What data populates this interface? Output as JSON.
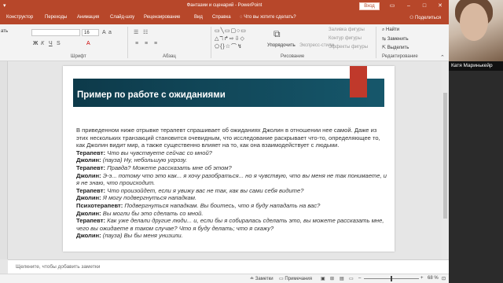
{
  "titlebar": {
    "title": "Фантазии и сценарий - PowerPoint",
    "login": "Вход"
  },
  "tabs": [
    "Конструктор",
    "Переходы",
    "Анимация",
    "Слайд-шоу",
    "Рецензирование",
    "Вид",
    "Справка"
  ],
  "tell_me": "Что вы хотите сделать?",
  "share": "Поделиться",
  "ribbon": {
    "paste_label": "ать",
    "font_size": "16",
    "groups": [
      "Шрифт",
      "Абзац",
      "Рисование",
      "Редактирование"
    ],
    "arrange": "Упорядочить",
    "quick_styles": "Экспресс-стили",
    "shape_fill": "Заливка фигуры",
    "shape_outline": "Контур фигуры",
    "shape_effects": "Эффекты фигуры",
    "find": "Найти",
    "replace": "Заменить",
    "select": "Выделить"
  },
  "slide": {
    "title": "Пример по работе с ожиданиями",
    "intro": "В приведенном ниже отрывке терапевт спрашивает об ожиданиях Джолин в отношении нее самой. Даже из этих нескольких транзакций становится очевидным, что исследование раскрывает что-то, определяющее то, как Джолин видит мир, а также существенно влияет на то, как она взаимодействует с людьми.",
    "lines": [
      {
        "speaker": "Терапевт:",
        "text": "Что вы чувствуете сейчас со мной?"
      },
      {
        "speaker": "Джолин:",
        "text": "(пауза) Ну, небольшую угрозу."
      },
      {
        "speaker": "Терапевт:",
        "text": "Правда? Можете рассказать мне об этом?"
      },
      {
        "speaker": "Джолин:",
        "text": "Э-э... потому что это как... я хочу разобраться... но я чувствую, что вы меня не так понимаете, и я не знаю, что происходит."
      },
      {
        "speaker": "Терапевт:",
        "text": "Что произойдет, если я увижу вас не так, как вы сами себя видите?"
      },
      {
        "speaker": "Джолин:",
        "text": "Я могу подвергнуться нападкам."
      },
      {
        "speaker": "Психотерапевт:",
        "text": "Подвергнуться нападкам. Вы боитесь, что я буду нападать на вас?"
      },
      {
        "speaker": "Джолин:",
        "text": "Вы могли бы это сделать со мной."
      },
      {
        "speaker": "Терапевт:",
        "text": "Как уже делали другие люди... и, если бы я собиралась сделать это, вы можете рассказать мне, чего вы ожидаете в таком случае? Что я буду делать; что я скажу?"
      },
      {
        "speaker": "Джолин:",
        "text": "(пауза) Вы бы меня унизили."
      }
    ]
  },
  "notes": {
    "placeholder": "Щелкните, чтобы добавить заметки"
  },
  "status": {
    "notes": "Заметки",
    "comments": "Примечания",
    "zoom": "68 %"
  },
  "webcam": {
    "name": "Катя Маринькейр"
  }
}
